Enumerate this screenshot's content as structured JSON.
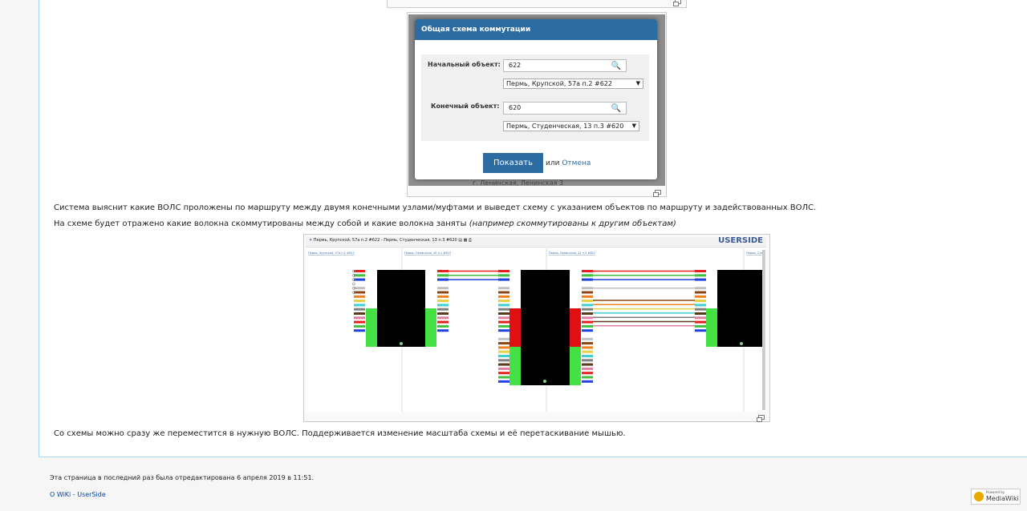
{
  "dialog": {
    "title": "Общая схема коммутации",
    "start_label": "Начальный объект:",
    "start_value": "622",
    "start_select": "Пермь, Крупской, 57а п.2 #622",
    "end_label": "Конечный объект:",
    "end_value": "620",
    "end_select": "Пермь, Студенческая, 13 п.3 #620",
    "show_button": "Показать",
    "or_text": "или",
    "cancel_link": "Отмена",
    "bg_text": "г. Ленинская, Ленинская 3"
  },
  "text": {
    "para1": "Система выяснит какие ВОЛС проложены по маршруту между двумя конечными узлами/муфтами и выведет схему с указанием объектов по маршруту и задействованных ВОЛС.",
    "para2_plain": "На схеме будет отражено какие волокна скоммутированы между собой и какие волокна заняты",
    "para2_italic": "(например скоммутированы к другим объектам)",
    "para3": "Со схемы можно сразу же переместится в нужную ВОЛС. Поддерживается изменение масштаба схемы и её перетаскивание мышью."
  },
  "diagram": {
    "title": "Пермь, Крупской, 57а п.2 #622 - Пермь, Студенческая, 13 п.3 #620",
    "brand": "USERSIDE",
    "col_labels": [
      "Пермь, Крупской, 57а п.2 #622",
      "Пермь, Ленинская, 49 п.1 #623",
      "Пермь, Ленинская, 12 п.3 #621",
      "Пермь, Ста"
    ]
  },
  "footer": {
    "last_edited": "Эта страница в последний раз была отредактирована 6 апреля 2019 в 11:51.",
    "about_link": "О WiKi - UserSide",
    "badge_top": "Powered by",
    "badge_bottom": "MediaWiki"
  },
  "colors": {
    "header_blue": "#2d6ca2",
    "link_blue": "#0645ad",
    "brand": "#3a5a9a"
  },
  "fiber_colors": [
    "#e62020",
    "#40c040",
    "#2040e0",
    "#ffffff",
    "#c0c0c0",
    "#8b4513",
    "#f08020",
    "#e6d040",
    "#40d0d0",
    "#808080",
    "#5a3a1a",
    "#e080a0"
  ]
}
